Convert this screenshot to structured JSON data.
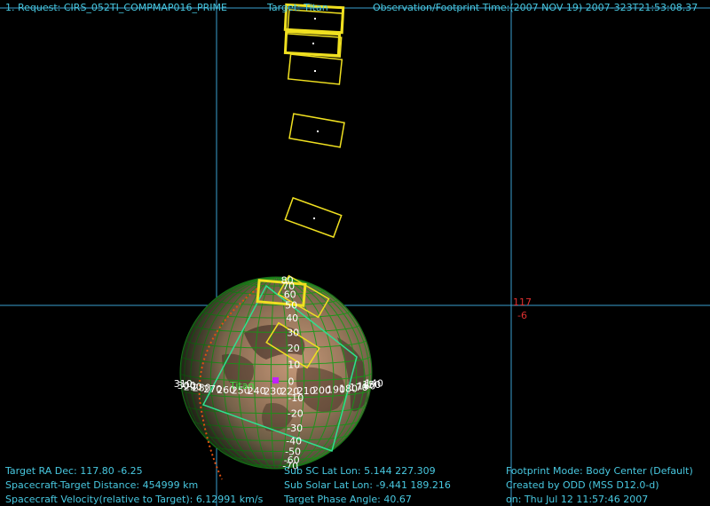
{
  "header": {
    "request": "1. Request: CIRS_052TI_COMPMAP016_PRIME",
    "target": "Target: Titan",
    "observation_time": "Observation/Footprint Time:(2007 NOV 19) 2007-323T21:53:08.37"
  },
  "crosshair": {
    "ra_label": "117",
    "dec_label": "-6"
  },
  "body": {
    "name": "Titan",
    "latitude_labels": [
      "80",
      "70",
      "60",
      "50",
      "40",
      "30",
      "20",
      "10",
      "0",
      "-10",
      "-20",
      "-30",
      "-40",
      "-50",
      "-60",
      "-70"
    ],
    "longitude_labels": [
      "310",
      "300",
      "290",
      "280",
      "270",
      "260",
      "250",
      "240",
      "230",
      "220",
      "210",
      "200",
      "190",
      "180",
      "170",
      "160",
      "150",
      "140"
    ]
  },
  "footer_left": {
    "ra_dec": "Target RA Dec: 117.80  -6.25",
    "distance": "Spacecraft-Target Distance:  454999 km",
    "velocity": "Spacecraft Velocity(relative to Target): 6.12991 km/s"
  },
  "footer_mid": {
    "sub_sc": "Sub SC Lat Lon:  5.144  227.309",
    "sub_solar": "Sub Solar Lat Lon:  -9.441  189.216",
    "phase": "Target Phase Angle: 40.67"
  },
  "footer_right": {
    "mode": "Footprint Mode: Body Center (Default)",
    "created": "Created by ODD (MSS D12.0-d)",
    "date": "on: Thu Jul 12 11:57:46 2007"
  },
  "colors": {
    "hud_text": "#48c8e0",
    "footprint": "#f0e020",
    "grid": "#18a018",
    "outline": "#30e090",
    "crosshair": "#3aa0d0",
    "terminator": "#e05010"
  }
}
